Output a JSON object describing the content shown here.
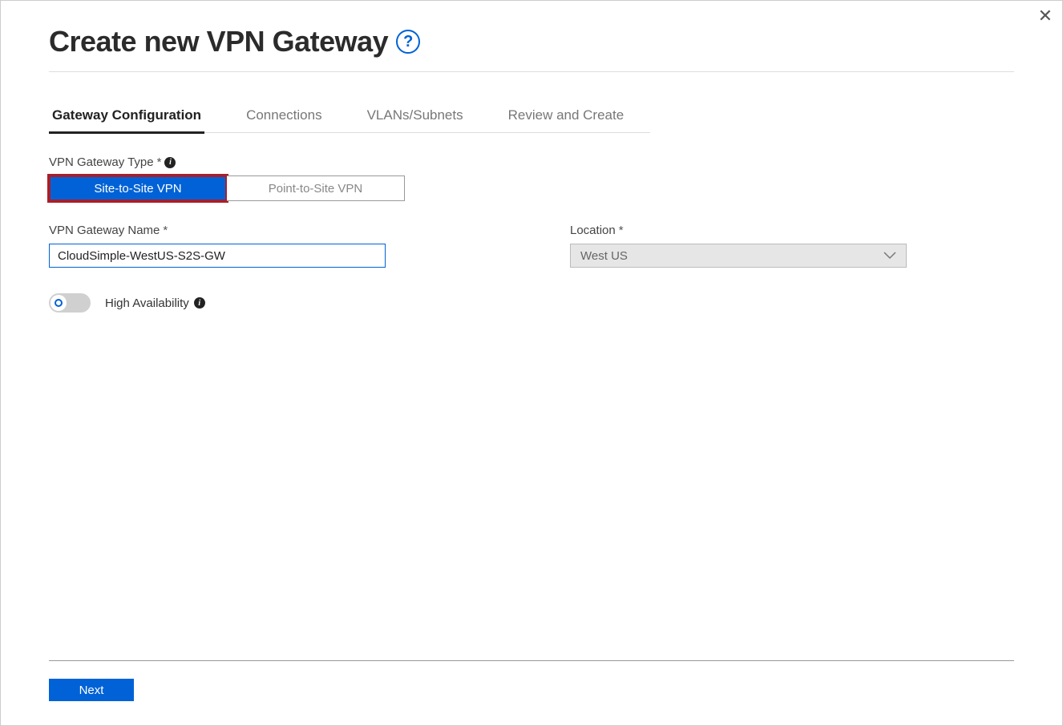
{
  "header": {
    "title": "Create new VPN Gateway"
  },
  "tabs": [
    {
      "label": "Gateway Configuration",
      "active": true
    },
    {
      "label": "Connections",
      "active": false
    },
    {
      "label": "VLANs/Subnets",
      "active": false
    },
    {
      "label": "Review and Create",
      "active": false
    }
  ],
  "gateway_type": {
    "label": "VPN Gateway Type",
    "required": "*",
    "options": {
      "site": "Site-to-Site VPN",
      "point": "Point-to-Site VPN"
    },
    "selected": "site"
  },
  "gateway_name": {
    "label": "VPN Gateway Name",
    "required": "*",
    "value": "CloudSimple-WestUS-S2S-GW"
  },
  "location": {
    "label": "Location",
    "required": "*",
    "value": "West US"
  },
  "ha": {
    "label": "High Availability",
    "enabled": false
  },
  "footer": {
    "next": "Next"
  }
}
